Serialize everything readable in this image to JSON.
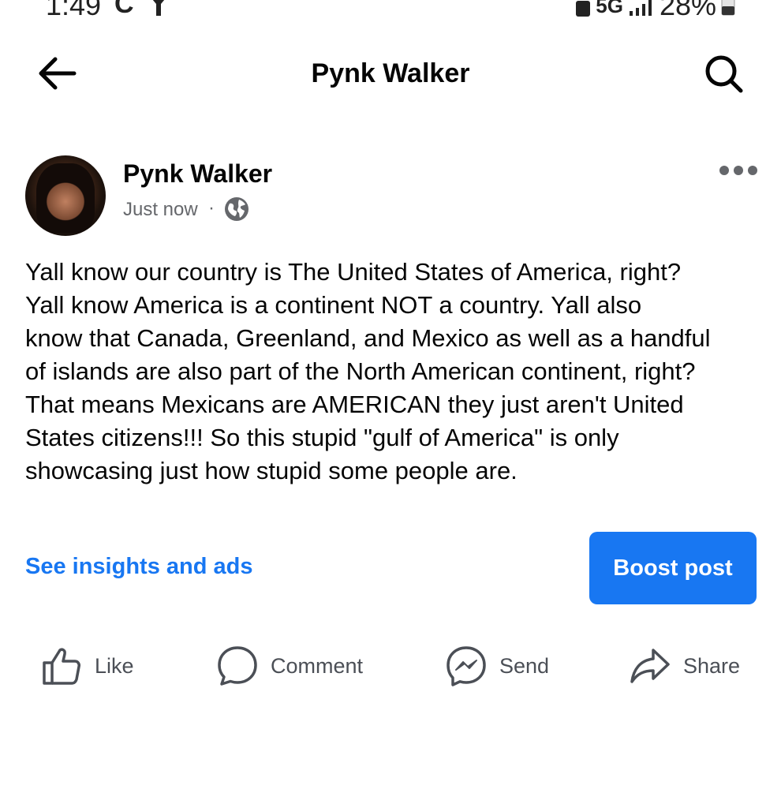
{
  "status_bar": {
    "time": "1:49",
    "carrier_glyph": "C",
    "network": "5G",
    "battery": "28%"
  },
  "app_bar": {
    "title": "Pynk Walker",
    "back_icon": "arrow-left-icon",
    "search_icon": "search-icon"
  },
  "post": {
    "author": "Pynk Walker",
    "time": "Just now",
    "separator": "·",
    "privacy_icon": "globe-icon",
    "body_lines": [
      "Yall know our country is The United States of America, right?",
      "Yall know America is a continent NOT a country. Yall also",
      "know that Canada, Greenland, and Mexico as well as a handful",
      "of islands are also part of the North American continent, right?",
      "That means Mexicans are AMERICAN they just aren't United",
      "States citizens!!! So this stupid \"gulf of America\" is only",
      "showcasing just how stupid some people are."
    ]
  },
  "promo": {
    "insights_label": "See insights and ads",
    "boost_label": "Boost post"
  },
  "actions": {
    "like": "Like",
    "comment": "Comment",
    "send": "Send",
    "share": "Share"
  },
  "colors": {
    "accent": "#1877f2",
    "secondary_text": "#65676b"
  }
}
